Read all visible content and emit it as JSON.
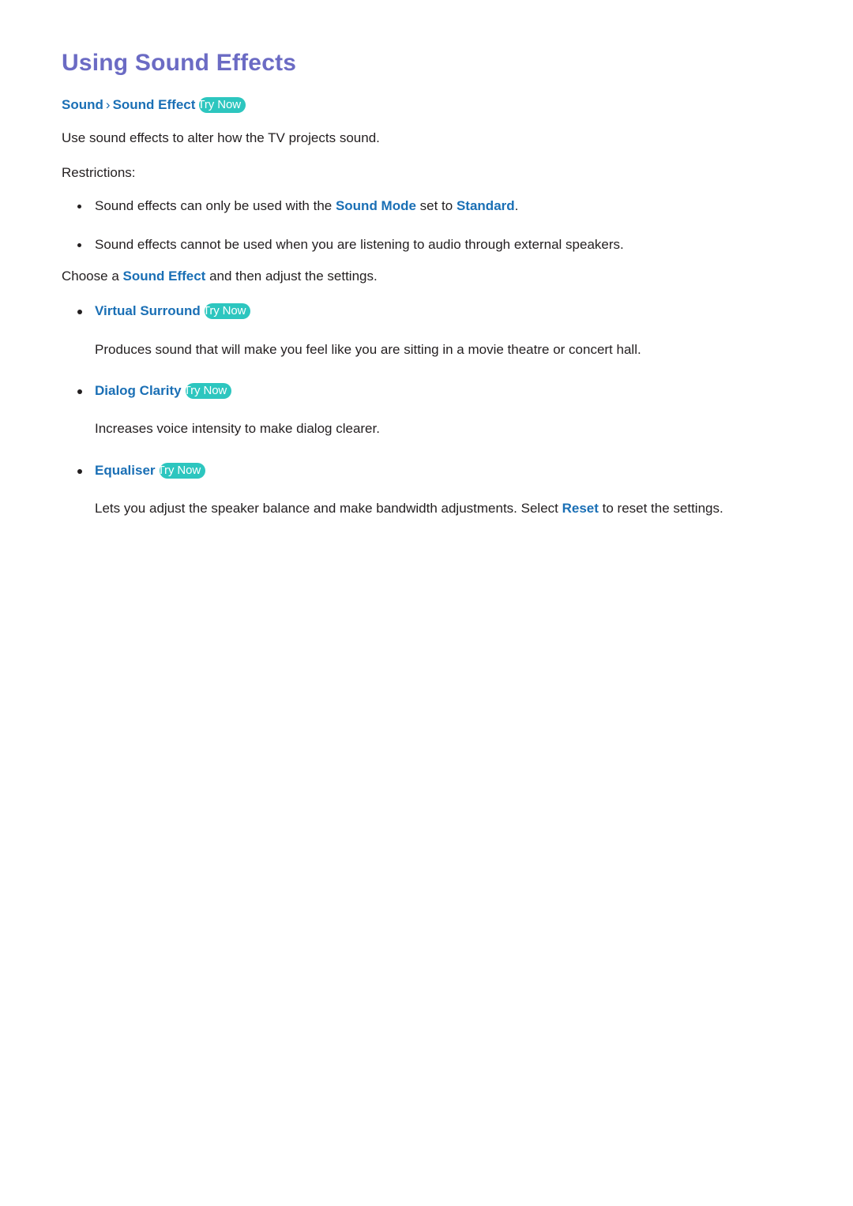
{
  "page": {
    "title": "Using Sound Effects",
    "title_color": "#6b6bc4",
    "link_color": "#1a6fb5",
    "badge_color": "#2dc6bf",
    "body_color": "#231f20",
    "background": "#ffffff"
  },
  "breadcrumb": {
    "root": "Sound",
    "separator": "›",
    "leaf": "Sound Effect",
    "badge": "Try Now"
  },
  "intro": {
    "text": "Use sound effects to alter how the TV projects sound."
  },
  "restrictions": {
    "heading": "Restrictions:",
    "items": [
      {
        "prefix": "Sound effects can only be used with the ",
        "term1": "Sound Mode",
        "middle": " set to ",
        "term2": "Standard",
        "suffix": "."
      },
      {
        "full": "Sound effects cannot be used when you are listening to audio through external speakers."
      }
    ]
  },
  "choose": {
    "prefix": "Choose a ",
    "term": "Sound Effect",
    "suffix": " and then adjust the settings."
  },
  "options": [
    {
      "label": "Virtual Surround",
      "badge": "Try Now",
      "description": "Produces sound that will make you feel like you are sitting in a movie theatre or concert hall."
    },
    {
      "label": "Dialog Clarity",
      "badge": "Try Now",
      "description": "Increases voice intensity to make dialog clearer."
    },
    {
      "label": "Equaliser",
      "badge": "Try Now",
      "description_prefix": "Lets you adjust the speaker balance and make bandwidth adjustments. Select ",
      "description_term": "Reset",
      "description_suffix": " to reset the settings."
    }
  ]
}
